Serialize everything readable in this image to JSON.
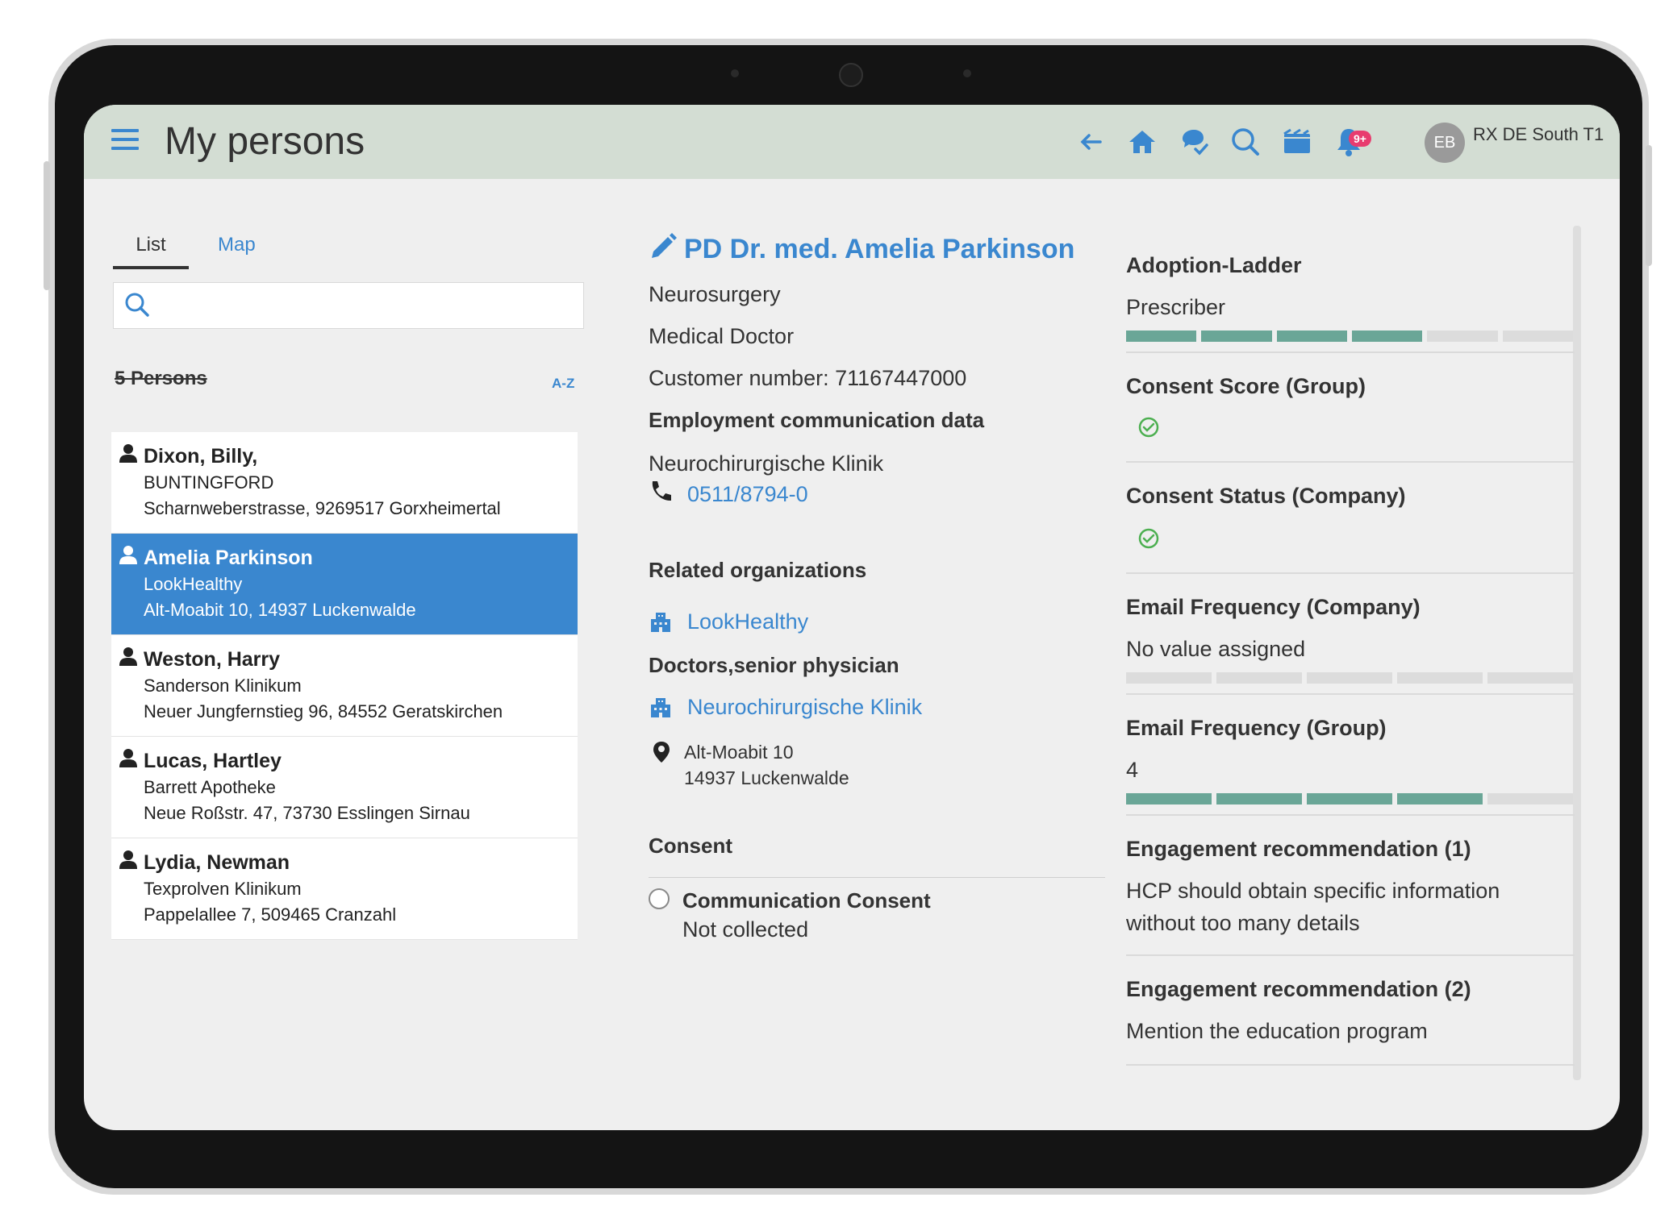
{
  "header": {
    "title": "My persons",
    "notification_badge": "9+",
    "avatar_initials": "EB",
    "account_name": "RX DE South T1",
    "icons": [
      "back-arrow-icon",
      "home-icon",
      "chat-check-icon",
      "search-icon",
      "calendar-icon",
      "bell-icon"
    ]
  },
  "list_panel": {
    "tabs": [
      {
        "label": "List"
      },
      {
        "label": "Map"
      }
    ],
    "search": {
      "placeholder": "",
      "value": ""
    },
    "count_label": "5 Persons",
    "sort_label": "A-Z",
    "persons": [
      {
        "name": "Dixon, Billy,",
        "org": "BUNTINGFORD",
        "address": "Scharnweberstrasse, 9269517 Gorxheimertal",
        "selected": false
      },
      {
        "name": "Amelia Parkinson",
        "org": "LookHealthy",
        "address": "Alt-Moabit 10, 14937 Luckenwalde",
        "selected": true
      },
      {
        "name": "Weston, Harry",
        "org": "Sanderson Klinikum",
        "address": "Neuer Jungfernstieg 96, 84552 Geratskirchen",
        "selected": false
      },
      {
        "name": "Lucas, Hartley",
        "org": "Barrett Apotheke",
        "address": "Neue Roßstr. 47, 73730 Esslingen Sirnau",
        "selected": false
      },
      {
        "name": "Lydia, Newman",
        "org": "Texprolven Klinikum",
        "address": "Pappelallee 7, 509465 Cranzahl",
        "selected": false
      }
    ]
  },
  "detail": {
    "name": "PD Dr. med. Amelia Parkinson",
    "specialty": "Neurosurgery",
    "role": "Medical Doctor",
    "customer_number": "Customer number: 71167447000",
    "employment_heading": "Employment communication data",
    "employment_org": "Neurochirurgische Klinik",
    "phone": "0511/8794-0",
    "related_heading": "Related organizations",
    "related_org_1": "LookHealthy",
    "position_heading": "Doctors,senior physician",
    "related_org_2": "Neurochirurgische Klinik",
    "address_line1": "Alt-Moabit 10",
    "address_line2": "14937 Luckenwalde",
    "consent_heading": "Consent",
    "consent_label": "Communication Consent",
    "consent_value": "Not collected"
  },
  "metrics": {
    "adoption_label": "Adoption-Ladder",
    "adoption_value": "Prescriber",
    "adoption_level": 4,
    "adoption_max": 6,
    "consent_score_label": "Consent Score (Group)",
    "consent_status_label": "Consent Status (Company)",
    "email_freq_company_label": "Email Frequency (Company)",
    "email_freq_company_value": "No value assigned",
    "email_freq_company_level": 0,
    "email_freq_company_max": 5,
    "email_freq_group_label": "Email Frequency (Group)",
    "email_freq_group_value": "4",
    "email_freq_group_level": 4,
    "email_freq_group_max": 5,
    "engagement1_label": "Engagement recommendation (1)",
    "engagement1_line1": "HCP should obtain specific information",
    "engagement1_line2": "without too many details",
    "engagement2_label": "Engagement recommendation (2)",
    "engagement2_value": "Mention the education program"
  },
  "colors": {
    "accent": "#3a87cf",
    "header_bg": "#d3ddd3",
    "ladder_on": "#6aa697",
    "ladder_off": "#dcdcdc",
    "badge": "#e83c6f",
    "check": "#4caf50"
  }
}
